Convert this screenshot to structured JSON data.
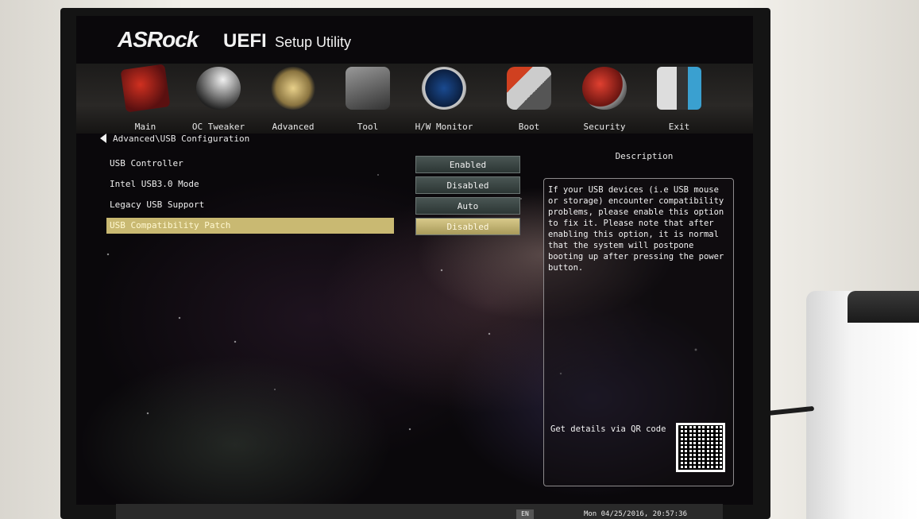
{
  "header": {
    "brand": "ASRock",
    "uefi": "UEFI",
    "setup": "Setup Utility"
  },
  "nav": {
    "items": [
      {
        "label": "Main",
        "icon": "main-icon"
      },
      {
        "label": "OC Tweaker",
        "icon": "oc-tweaker-icon"
      },
      {
        "label": "Advanced",
        "icon": "advanced-star-icon"
      },
      {
        "label": "Tool",
        "icon": "tool-icon"
      },
      {
        "label": "H/W Monitor",
        "icon": "radar-icon"
      },
      {
        "label": "Boot",
        "icon": "boot-icon"
      },
      {
        "label": "Security",
        "icon": "shield-icon"
      },
      {
        "label": "Exit",
        "icon": "exit-icon"
      }
    ]
  },
  "breadcrumb": "Advanced\\USB Configuration",
  "settings": [
    {
      "label": "USB Controller",
      "value": "Enabled"
    },
    {
      "label": "Intel USB3.0 Mode",
      "value": "Disabled"
    },
    {
      "label": "Legacy USB Support",
      "value": "Auto"
    },
    {
      "label": "USB Compatibility Patch",
      "value": "Disabled",
      "selected": true
    }
  ],
  "description": {
    "title": "Description",
    "text": "If your USB devices (i.e USB mouse or storage) encounter compatibility problems, please enable this option to fix it. Please note that after enabling this option, it is normal that the system will postpone booting up after pressing the power button.",
    "qr_label": "Get details via QR code"
  },
  "footer": {
    "language": "EN",
    "datetime": "Mon 04/25/2016, 20:57:36"
  },
  "colors": {
    "selected_row": "#c9b972",
    "value_button": "#3a4644",
    "background": "#0a080b"
  }
}
